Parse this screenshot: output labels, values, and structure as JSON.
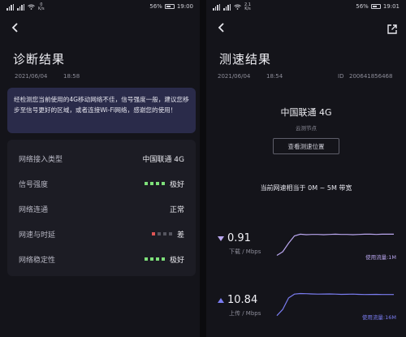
{
  "left": {
    "status": {
      "net_speed": "0",
      "net_unit": "K/s",
      "battery": "56%",
      "time": "19:00"
    },
    "title": "诊断结果",
    "date": "2021/06/04",
    "time": "18:58",
    "notice": "经检测您当前使用的4G移动网络不佳，信号强度一般，建议您移步至信号更好的区域，或者连接Wi-Fi网络，感谢您的使用！",
    "rows": [
      {
        "label": "网络接入类型",
        "value": "中国联通 4G"
      },
      {
        "label": "信号强度",
        "value": "极好",
        "level": 4,
        "max": 4,
        "color": "#7ee07a"
      },
      {
        "label": "网络连通",
        "value": "正常"
      },
      {
        "label": "网速与时延",
        "value": "差",
        "level": 1,
        "max": 4,
        "color": "#e05555"
      },
      {
        "label": "网络稳定性",
        "value": "极好",
        "level": 4,
        "max": 4,
        "color": "#7ee07a"
      }
    ]
  },
  "right": {
    "status": {
      "net_speed": "2.1",
      "net_unit": "K/s",
      "battery": "56%",
      "time": "19:01"
    },
    "title": "测速结果",
    "date": "2021/06/04",
    "time": "18:54",
    "id_label": "ID",
    "id_value": "200641856468",
    "operator": "中国联通 4G",
    "node": "云测节点",
    "location_button": "查看测速位置",
    "bandwidth_text": "当前网速相当于 0M ~ 5M 带宽",
    "download": {
      "value": "0.91",
      "unit": "下载 / Mbps",
      "usage": "使用流量:1M",
      "color": "#b9a6ee"
    },
    "upload": {
      "value": "10.84",
      "unit": "上传 / Mbps",
      "usage": "使用流量:16M",
      "color": "#7a7cf0"
    }
  },
  "chart_data": [
    {
      "type": "line",
      "name": "download",
      "x": [
        0,
        1,
        2,
        3,
        4,
        5,
        6,
        7,
        8,
        9,
        10,
        11,
        12,
        13,
        14,
        15,
        16,
        17,
        18,
        19,
        20
      ],
      "y": [
        0.05,
        0.2,
        0.55,
        0.85,
        0.92,
        0.9,
        0.91,
        0.91,
        0.9,
        0.91,
        0.92,
        0.91,
        0.91,
        0.9,
        0.91,
        0.92,
        0.92,
        0.91,
        0.92,
        0.92,
        0.92
      ],
      "ylim": [
        0,
        1.2
      ],
      "color": "#b9a6ee"
    },
    {
      "type": "line",
      "name": "upload",
      "x": [
        0,
        1,
        2,
        3,
        4,
        5,
        6,
        7,
        8,
        9,
        10,
        11,
        12,
        13,
        14,
        15,
        16,
        17,
        18,
        19,
        20
      ],
      "y": [
        0.5,
        3.5,
        9.0,
        10.8,
        11.1,
        11.0,
        10.9,
        10.8,
        10.85,
        10.9,
        10.8,
        10.7,
        10.75,
        10.8,
        10.7,
        10.6,
        10.65,
        10.7,
        10.6,
        10.6,
        10.6
      ],
      "ylim": [
        0,
        14
      ],
      "color": "#7a7cf0"
    }
  ]
}
